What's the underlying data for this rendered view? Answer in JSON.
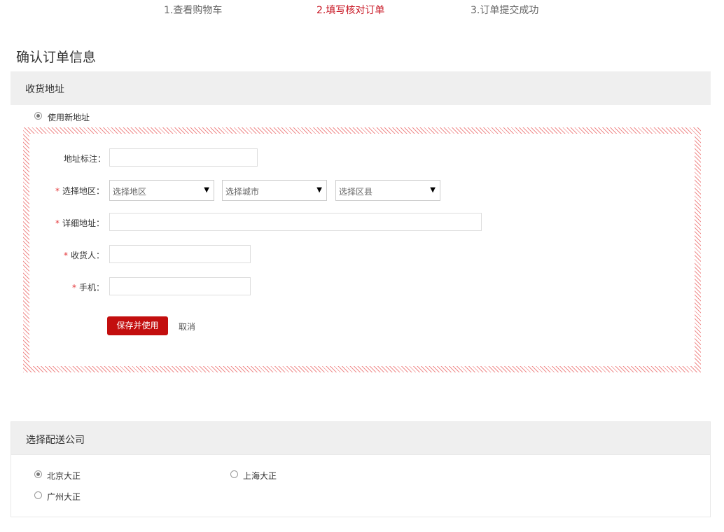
{
  "steps": [
    {
      "label": "1.查看购物车",
      "active": false
    },
    {
      "label": "2.填写核对订单",
      "active": true
    },
    {
      "label": "3.订单提交成功",
      "active": false
    }
  ],
  "page_title": "确认订单信息",
  "address_section": {
    "title": "收货地址",
    "new_address_option": {
      "label": "使用新地址",
      "checked": true
    },
    "form": {
      "alias_label": "地址标注：",
      "region_label": "选择地区：",
      "region_selects": [
        {
          "value": "选择地区"
        },
        {
          "value": "选择城市"
        },
        {
          "value": "选择区县"
        }
      ],
      "detail_label": "详细地址：",
      "receiver_label": "收货人：",
      "phone_label": "手机：",
      "required_mark": "*",
      "save_button": "保存并使用",
      "cancel_link": "取消"
    }
  },
  "shipping_section": {
    "title": "选择配送公司",
    "options": [
      {
        "label": "北京大正",
        "checked": true
      },
      {
        "label": "上海大正",
        "checked": false
      },
      {
        "label": "广州大正",
        "checked": false
      }
    ]
  },
  "colors": {
    "accent": "#c81623",
    "button": "#c30e0e",
    "stripe": "#ef8c8c",
    "section_bg": "#efefef"
  },
  "icons": {
    "select_caret": "▼"
  }
}
